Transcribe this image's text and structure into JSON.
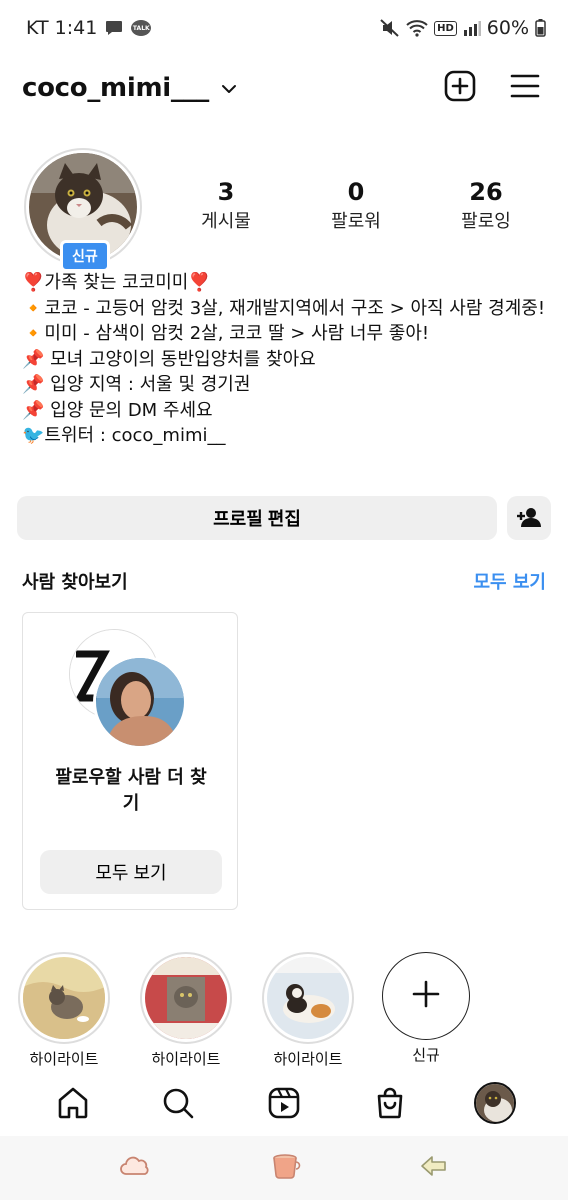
{
  "status_bar": {
    "carrier_time": "KT 1:41",
    "battery": "60%",
    "talk_badge": "TALK",
    "hd_badge": "HD",
    "icons": [
      "chat-bubble-icon",
      "talk-icon",
      "mute-icon",
      "wifi-icon",
      "hd-icon",
      "signal-icon",
      "battery-icon"
    ]
  },
  "header": {
    "username": "coco_mimi___",
    "icons": [
      "chevron-down-icon",
      "create-plus-icon",
      "menu-icon"
    ]
  },
  "profile": {
    "new_badge": "신규",
    "stats": [
      {
        "num": "3",
        "label": "게시물"
      },
      {
        "num": "0",
        "label": "팔로워"
      },
      {
        "num": "26",
        "label": "팔로잉"
      }
    ],
    "bio_lines": [
      "❣️가족 찾는 코코미미❣️",
      "🔸코코 - 고등어 암컷 3살, 재개발지역에서 구조 > 아직 사람 경계중!",
      "🔸미미 - 삼색이 암컷 2살, 코코 딸 > 사람 너무 좋아!",
      "📌 모녀 고양이의 동반입양처를 찾아요",
      "📌 입양 지역 : 서울 및 경기권",
      "📌 입양 문의 DM 주세요",
      "🐦트위터 : coco_mimi__"
    ]
  },
  "actions": {
    "edit_profile": "프로필 편집"
  },
  "discover": {
    "title": "사람 찾아보기",
    "see_all": "모두 보기",
    "card_text": "팔로우할 사람 더 찾기",
    "card_button": "모두 보기"
  },
  "highlights": [
    {
      "label": "하이라이트"
    },
    {
      "label": "하이라이트"
    },
    {
      "label": "하이라이트"
    },
    {
      "label": "신규"
    }
  ],
  "bottom_nav": [
    "home-icon",
    "search-icon",
    "reels-icon",
    "shop-icon",
    "profile-avatar"
  ],
  "system_nav": [
    "recent-apps-icon",
    "home-cup-icon",
    "back-arrow-icon"
  ]
}
